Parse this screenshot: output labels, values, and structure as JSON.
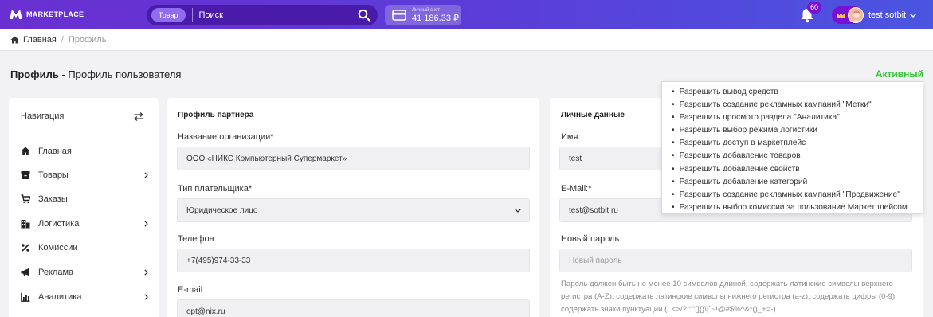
{
  "header": {
    "logo_text": "MARKETPLACE",
    "search": {
      "category": "Товар",
      "placeholder": "Поиск"
    },
    "account": {
      "label": "Личный счет",
      "amount": "41 186.33 ₽"
    },
    "notifications_count": "60",
    "user_name": "test sotbit"
  },
  "breadcrumb": {
    "home": "Главная",
    "separator": "/",
    "current": "Профиль"
  },
  "page": {
    "title_bold": "Профиль",
    "title_rest": " - Профиль пользователя",
    "status": "Активный",
    "status_color": "#34c634"
  },
  "sidebar": {
    "title": "Навигация",
    "items": [
      {
        "label": "Главная",
        "icon": "home-icon"
      },
      {
        "label": "Товары",
        "icon": "box-icon"
      },
      {
        "label": "Заказы",
        "icon": "cart-icon"
      },
      {
        "label": "Логистика",
        "icon": "building-icon"
      },
      {
        "label": "Комиссии",
        "icon": "percent-icon"
      },
      {
        "label": "Реклама",
        "icon": "megaphone-icon"
      },
      {
        "label": "Аналитика",
        "icon": "chart-icon"
      }
    ]
  },
  "partner": {
    "title": "Профиль партнера",
    "org_label": "Название организации*",
    "org_value": "ООО «НИКС Компьютерный Супермаркет»",
    "payer_label": "Тип плательщика*",
    "payer_value": "Юридическое лицо",
    "phone_label": "Телефон",
    "phone_value": "+7(495)974-33-33",
    "email_label": "E-mail",
    "email_value": "opt@nix.ru"
  },
  "personal": {
    "title": "Личные данные",
    "name_label": "Имя:",
    "name_value": "test",
    "email_label": "E-Mail:*",
    "email_value": "test@sotbit.ru",
    "password_label": "Новый пароль:",
    "password_placeholder": "Новый пароль",
    "password_hint": "Пароль должен быть не менее 10 символов длиной, содержать латинские символы верхнего регистра (A-Z), содержать латинские символы нижнего регистра (a-z), содержать цифры (0-9), содержать знаки пунктуации (,.<>/?;:'\"[]{}\\|`~!@#$%^&*()_+=-)."
  },
  "permissions": [
    "Разрешить вывод средств",
    "Разрешить создание рекламных кампаний \"Метки\"",
    "Разрешить просмотр раздела \"Аналитика\"",
    "Разрешить выбор режима логистики",
    "Разрешить доступ в маркетплейс",
    "Разрешить добавление товаров",
    "Разрешить добавление свойств",
    "Разрешить добавление категорий",
    "Разрешить создание рекламных кампаний \"Продвижение\"",
    "Разрешить выбор комиссии за пользование Маркетплейсом"
  ]
}
